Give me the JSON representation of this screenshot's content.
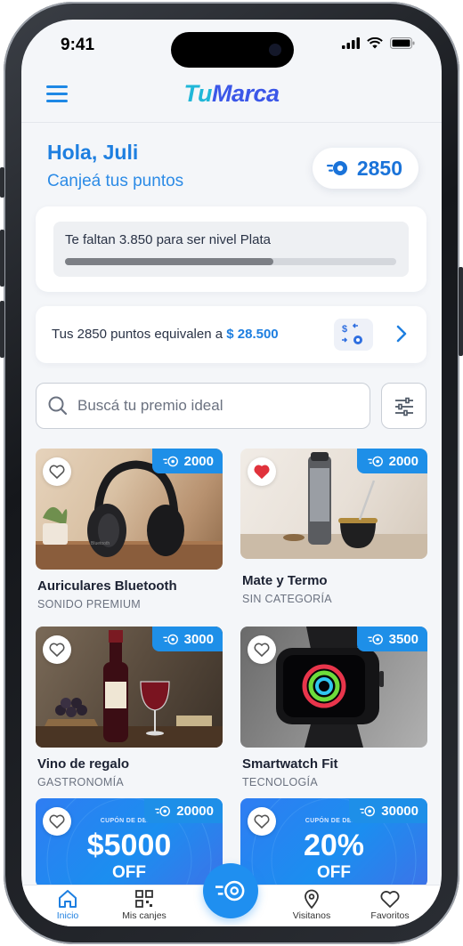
{
  "status_bar": {
    "time": "9:41"
  },
  "header": {
    "brand_part1": "Tu",
    "brand_part2": "Marca"
  },
  "greeting": {
    "title": "Hola, Juli",
    "subtitle": "Canjeá tus puntos"
  },
  "points": {
    "balance": "2850"
  },
  "level": {
    "message": "Te faltan 3.850 para ser nivel Plata",
    "progress": 0.63
  },
  "equivalence": {
    "text": "Tus 2850 puntos equivalen a ",
    "amount": "$ 28.500"
  },
  "search": {
    "placeholder": "Buscá tu premio ideal"
  },
  "products": [
    {
      "name": "Auriculares Bluetooth",
      "category": "SONIDO PREMIUM",
      "points": "2000",
      "favorite": false
    },
    {
      "name": "Mate y Termo",
      "category": "SIN CATEGORÍA",
      "points": "2000",
      "favorite": true
    },
    {
      "name": "Vino de regalo",
      "category": "GASTRONOMÍA",
      "points": "3000",
      "favorite": false
    },
    {
      "name": "Smartwatch Fit",
      "category": "TECNOLOGÍA",
      "points": "3500",
      "favorite": false
    },
    {
      "coupon_label": "CUPÓN DE DESC.",
      "coupon_value": "$5000",
      "coupon_off": "OFF",
      "points": "20000",
      "favorite": false
    },
    {
      "coupon_label": "CUPÓN DE DESC.",
      "coupon_value": "20%",
      "coupon_off": "OFF",
      "points": "30000",
      "favorite": false
    }
  ],
  "bottom_nav": [
    {
      "label": "Inicio",
      "icon": "home-icon",
      "active": true
    },
    {
      "label": "Mis canjes",
      "icon": "qr-icon",
      "active": false
    },
    {
      "label": "Visitanos",
      "icon": "location-pin-icon",
      "active": false
    },
    {
      "label": "Favoritos",
      "icon": "heart-icon",
      "active": false
    }
  ],
  "colors": {
    "accent": "#1e8fe8",
    "brand_cyan": "#20b7d8",
    "brand_indigo": "#3b57e8",
    "heart_red": "#e0323c"
  }
}
